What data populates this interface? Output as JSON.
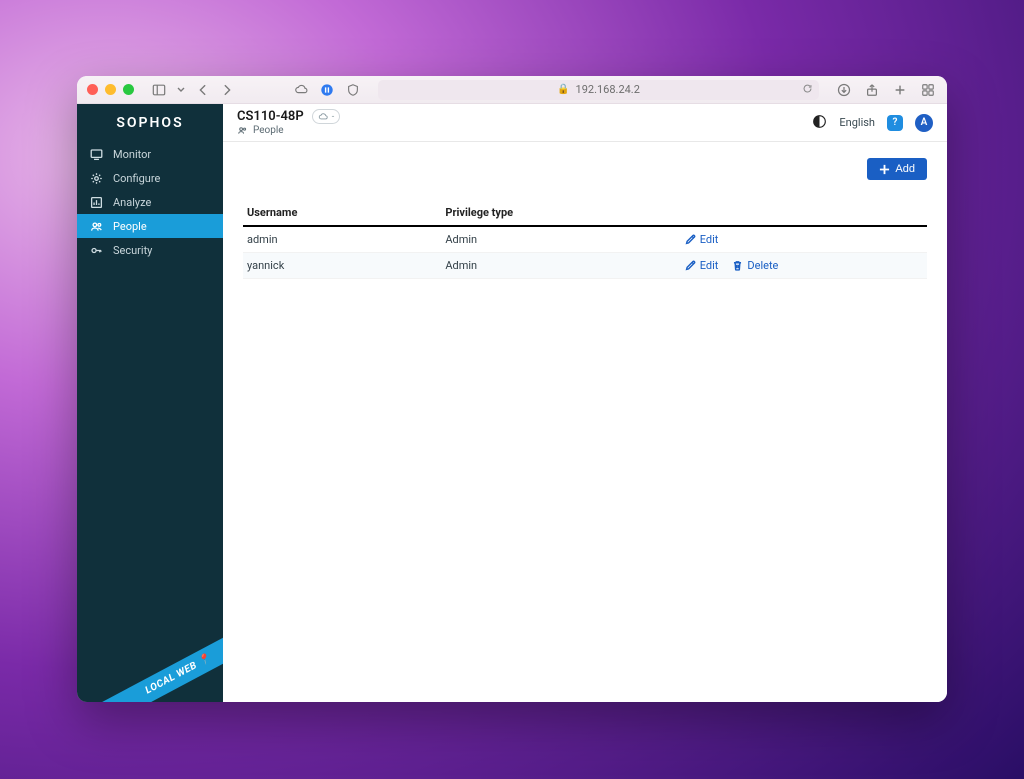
{
  "browser": {
    "address": "192.168.24.2"
  },
  "sidebar": {
    "brand": "SOPHOS",
    "items": [
      {
        "label": "Monitor"
      },
      {
        "label": "Configure"
      },
      {
        "label": "Analyze"
      },
      {
        "label": "People"
      },
      {
        "label": "Security"
      }
    ],
    "ribbon": "LOCAL WEB 📍"
  },
  "topbar": {
    "device_name": "CS110-48P",
    "cloud_status": "-",
    "breadcrumb_label": "People",
    "language": "English",
    "help_badge": "?",
    "avatar_initial": "A"
  },
  "content": {
    "add_button": "Add",
    "table": {
      "headers": {
        "username": "Username",
        "privilege": "Privilege type"
      },
      "rows": [
        {
          "username": "admin",
          "privilege": "Admin",
          "can_delete": false
        },
        {
          "username": "yannick",
          "privilege": "Admin",
          "can_delete": true
        }
      ],
      "actions": {
        "edit": "Edit",
        "delete": "Delete"
      }
    }
  }
}
